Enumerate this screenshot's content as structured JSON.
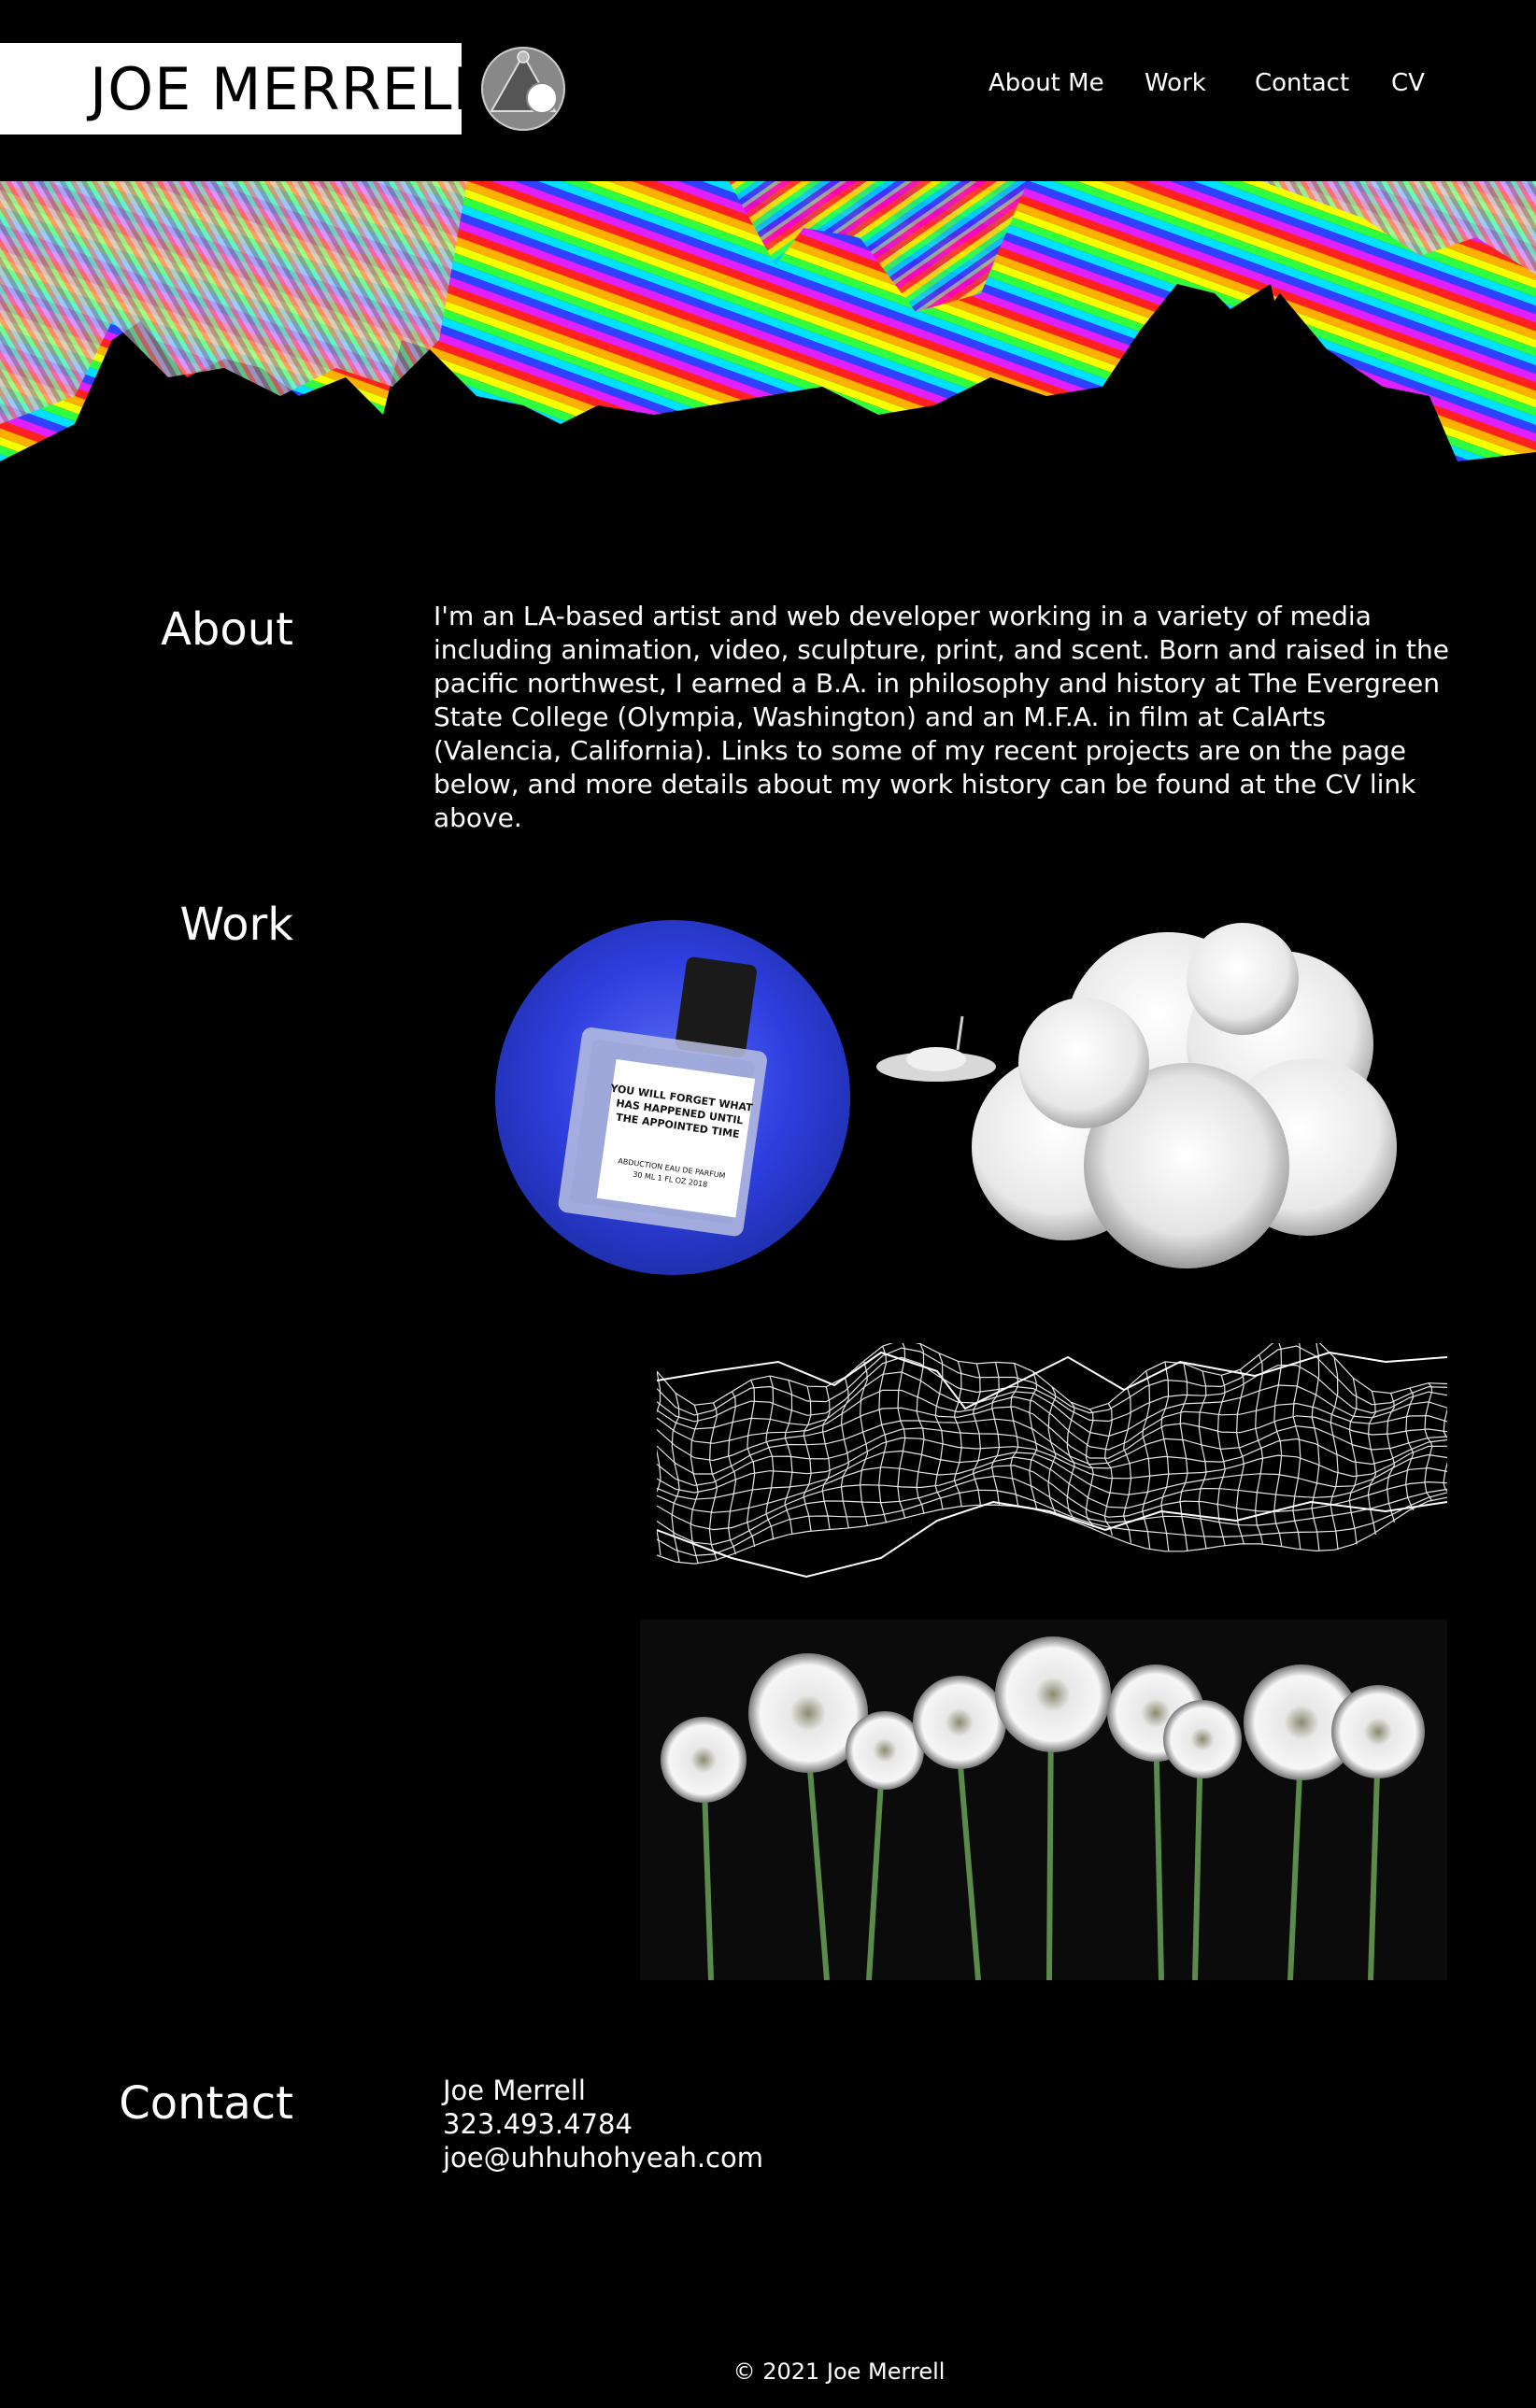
{
  "header": {
    "logo_text": "JOE MERRELL",
    "logo_icon": "triangle-circle-logo-icon",
    "nav": [
      {
        "label": "About Me"
      },
      {
        "label": "Work"
      },
      {
        "label": "Contact"
      },
      {
        "label": "CV"
      }
    ]
  },
  "about": {
    "title": "About",
    "body": "I'm an LA-based artist and web developer working in a variety of media including animation, video, sculpture, print, and scent. Born and raised in the pacific northwest, I earned a B.A. in philosophy and history at The Evergreen State College (Olympia, Washington) and an M.F.A. in film at CalArts (Valencia, California). Links to some of my recent projects are on the page below, and more details about my work history can be found at the CV link above."
  },
  "work": {
    "title": "Work",
    "perfume_label": {
      "line1": "YOU WILL FORGET WHAT",
      "line2": "HAS HAPPENED UNTIL",
      "line3": "THE APPOINTED TIME",
      "product": "ABDUCTION EAU DE PARFUM",
      "size": "30 ML  1 FL OZ  2018"
    },
    "items": [
      "perfume-bottle",
      "ufo-cloud",
      "wireframe-mountains",
      "dandelions"
    ]
  },
  "contact": {
    "title": "Contact",
    "name": "Joe Merrell",
    "phone": "323.493.4784",
    "email": "joe@uhhuhohyeah.com"
  },
  "footer": {
    "copyright": "© 2021 Joe Merrell"
  },
  "colors": {
    "background": "#000000",
    "text": "#ffffff",
    "perfume_circle": "#2e3fe0"
  }
}
